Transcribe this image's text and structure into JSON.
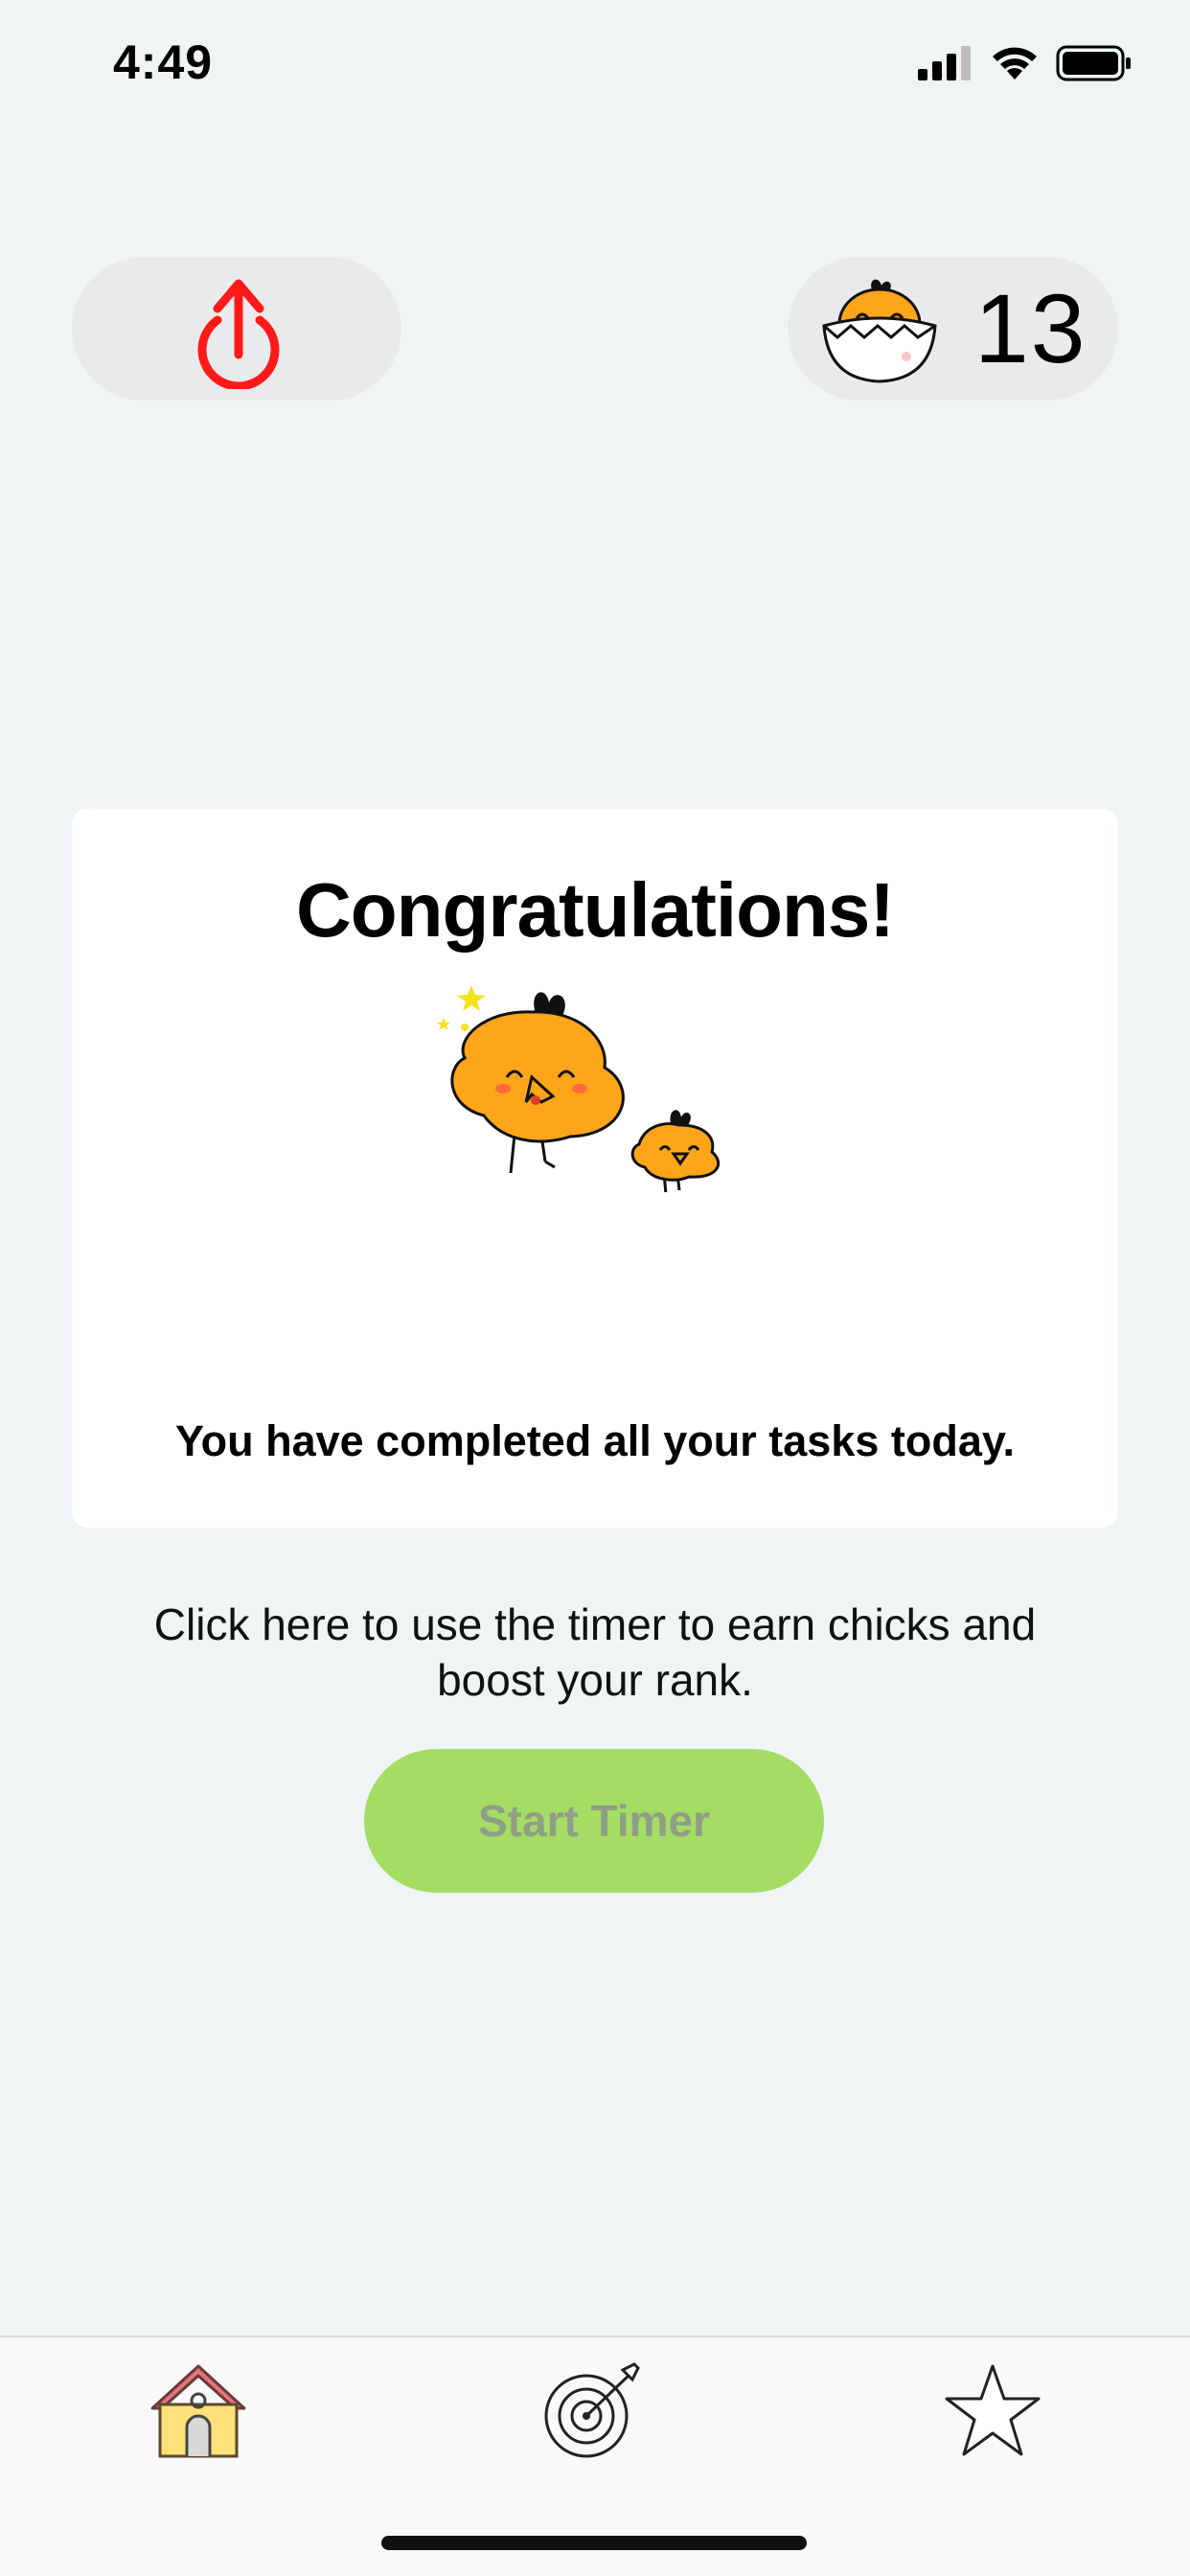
{
  "status_bar": {
    "time": "4:49"
  },
  "header": {
    "chick_count": "13"
  },
  "card": {
    "title": "Congratulations!",
    "message": "You have completed all your tasks today."
  },
  "hint": "Click here to use the timer to earn chicks and boost your rank.",
  "start_button_label": "Start Timer",
  "colors": {
    "background": "#eff5f5",
    "accent_green": "#a4dc64",
    "power_red": "#ff1a1a",
    "chick_orange": "#ffa51a"
  },
  "tabs": [
    {
      "icon": "home-icon"
    },
    {
      "icon": "target-icon"
    },
    {
      "icon": "star-icon"
    }
  ]
}
